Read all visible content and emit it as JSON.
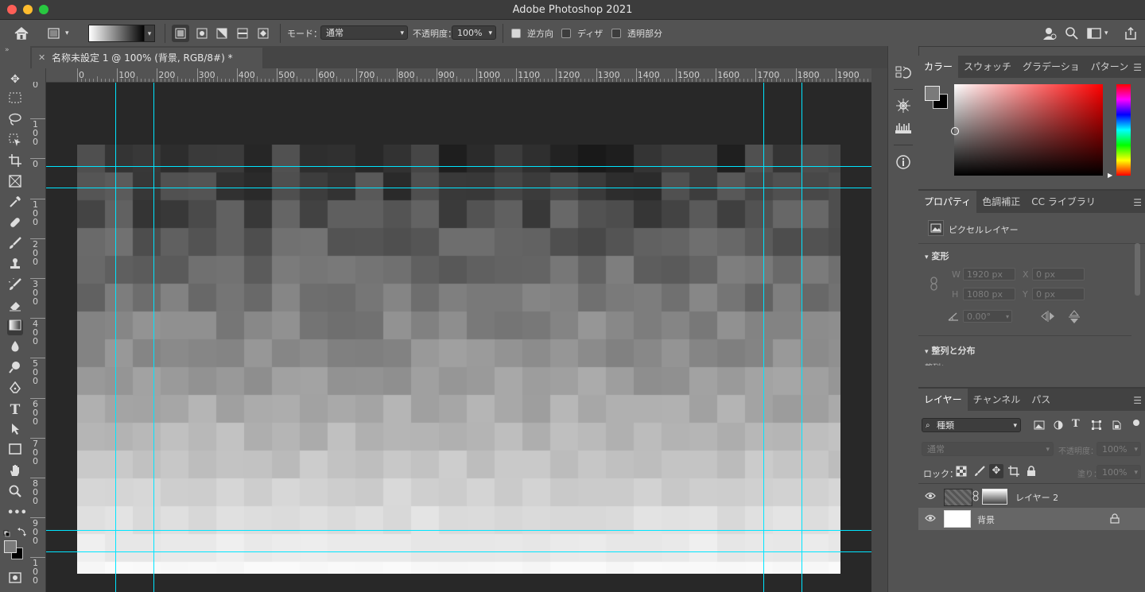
{
  "window": {
    "title": "Adobe Photoshop 2021"
  },
  "options_bar": {
    "mode_label": "モード：",
    "mode_value": "通常",
    "opacity_label": "不透明度：",
    "opacity_value": "100%",
    "reverse_label": "逆方向",
    "reverse_checked": true,
    "dither_label": "ディザ",
    "dither_checked": false,
    "transparency_label": "透明部分",
    "transparency_checked": false
  },
  "document": {
    "tab_title": "名称未設定 1 @ 100% (背景, RGB/8#) *",
    "ruler_h_labels": [
      "0",
      "100",
      "200",
      "300",
      "400",
      "500",
      "600",
      "700",
      "800",
      "900",
      "1000",
      "1100",
      "1200",
      "1300",
      "1400",
      "1500",
      "1600",
      "1700",
      "1800",
      "1900"
    ],
    "ruler_v_labels": [
      [
        "0"
      ],
      [
        "1",
        "0",
        "0"
      ],
      [
        "0"
      ],
      [
        "1",
        "0",
        "0"
      ],
      [
        "2",
        "0",
        "0"
      ],
      [
        "3",
        "0",
        "0"
      ],
      [
        "4",
        "0",
        "0"
      ],
      [
        "5",
        "0",
        "0"
      ],
      [
        "6",
        "0",
        "0"
      ],
      [
        "7",
        "0",
        "0"
      ],
      [
        "8",
        "0",
        "0"
      ],
      [
        "9",
        "0",
        "0"
      ],
      [
        "1",
        "0",
        "0"
      ]
    ]
  },
  "color_panel": {
    "tabs": [
      "カラー",
      "スウォッチ",
      "グラデーショ",
      "パターン"
    ],
    "active_tab": 0,
    "hue_color": "#ff0000"
  },
  "properties_panel": {
    "tabs": [
      "プロパティ",
      "色調補正",
      "CC ライブラリ"
    ],
    "active_tab": 0,
    "layer_type": "ピクセルレイヤー",
    "transform_label": "変形",
    "w_label": "W",
    "w_value": "1920 px",
    "h_label": "H",
    "h_value": "1080 px",
    "x_label": "X",
    "x_value": "0 px",
    "y_label": "Y",
    "y_value": "0 px",
    "angle_value": "0.00°",
    "align_label": "整列と分布",
    "align_sub": "整列："
  },
  "layers_panel": {
    "tabs": [
      "レイヤー",
      "チャンネル",
      "パス"
    ],
    "active_tab": 0,
    "filter_kind": "種類",
    "blend_mode": "通常",
    "opacity_label": "不透明度：",
    "opacity_value": "100%",
    "lock_label": "ロック：",
    "fill_label": "塗り：",
    "fill_value": "100%",
    "layers": [
      {
        "name": "レイヤー 2",
        "visible": true,
        "selected": false,
        "locked": false
      },
      {
        "name": "背景",
        "visible": true,
        "selected": true,
        "locked": true
      }
    ]
  },
  "guides_color": "#00e5ff"
}
